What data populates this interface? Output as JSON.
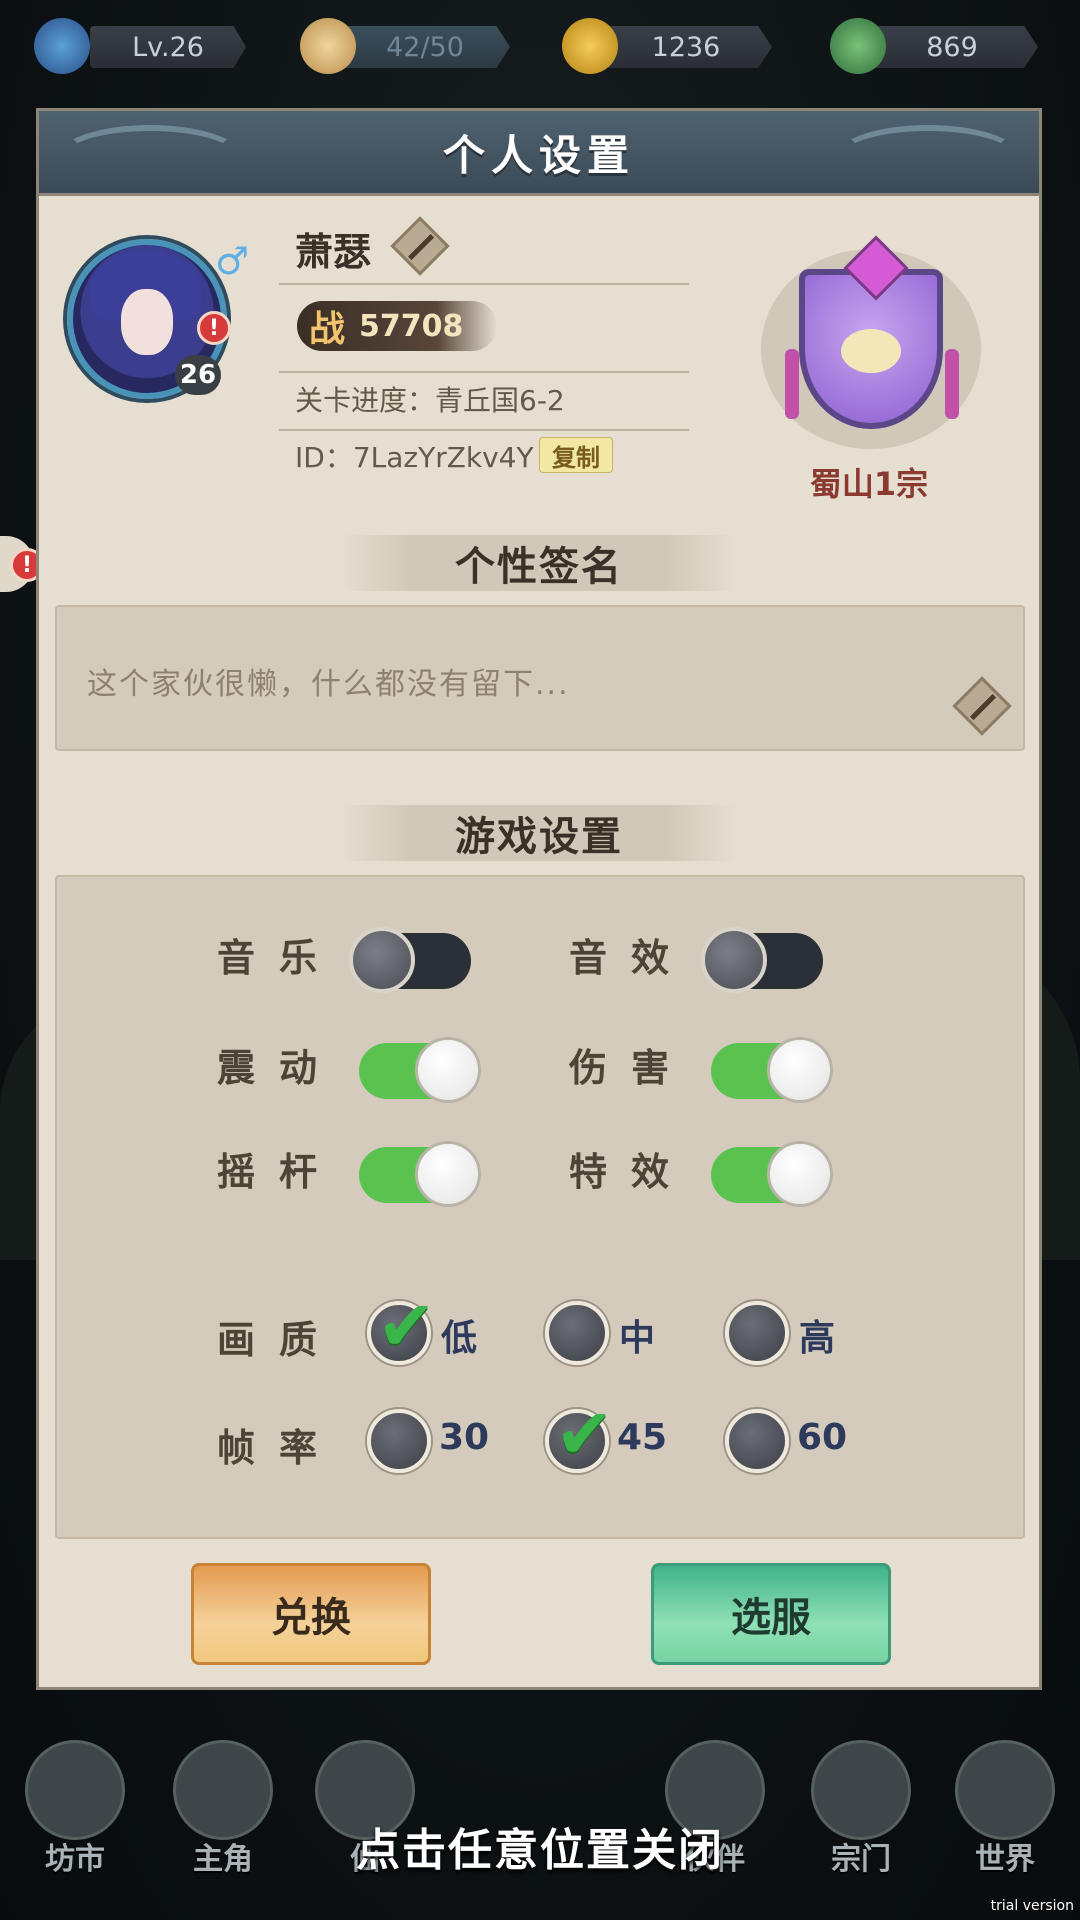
{
  "topbar": {
    "level": "Lv.26",
    "stamina": "42/50",
    "coins": "1236",
    "jade": "869"
  },
  "panel": {
    "title": "个人设置",
    "player": {
      "name": "萧瑟",
      "power_char": "战",
      "power": "57708",
      "avatar_level": "26",
      "progress": "关卡进度：青丘国6-2",
      "id": "ID：7LazYrZkv4Y",
      "copy_label": "复制"
    },
    "sect": {
      "name": "蜀山1宗"
    },
    "signature": {
      "title": "个性签名",
      "text": "这个家伙很懒，什么都没有留下..."
    },
    "game_settings": {
      "title": "游戏设置",
      "toggles": [
        {
          "label": "音乐",
          "on": false
        },
        {
          "label": "音效",
          "on": false
        },
        {
          "label": "震动",
          "on": true
        },
        {
          "label": "伤害",
          "on": true
        },
        {
          "label": "摇杆",
          "on": true
        },
        {
          "label": "特效",
          "on": true
        }
      ],
      "quality": {
        "label": "画质",
        "options": [
          "低",
          "中",
          "高"
        ],
        "selected": "低"
      },
      "framerate": {
        "label": "帧率",
        "options": [
          "30",
          "45",
          "60"
        ],
        "selected": "45"
      }
    },
    "buttons": {
      "redeem": "兑换",
      "server": "选服"
    }
  },
  "bottom_nav": [
    "坊市",
    "主角",
    "仙",
    "伙伴",
    "宗门",
    "世界"
  ],
  "close_hint": "点击任意位置关闭",
  "watermark": "trial version"
}
